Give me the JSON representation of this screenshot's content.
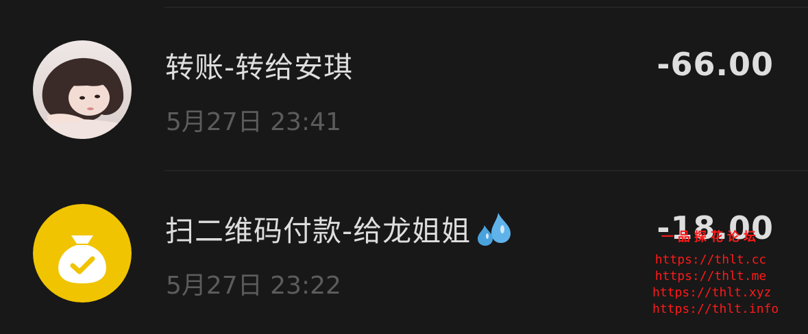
{
  "transactions": [
    {
      "title": "转账-转给安琪",
      "time": "5月27日 23:41",
      "amount": "-66.00",
      "avatar_icon": "user-avatar-photo"
    },
    {
      "title": "扫二维码付款-给龙姐姐",
      "time": "5月27日 23:22",
      "amount": "-18.00",
      "avatar_icon": "money-bag-check-icon",
      "title_emoji": "sweat-droplets-icon"
    }
  ],
  "watermark": {
    "title": "一品探花论坛",
    "lines": [
      "https://thlt.cc",
      "https://thlt.me",
      "https://thlt.xyz",
      "https://thlt.info"
    ]
  },
  "colors": {
    "background": "#181818",
    "text_primary": "#dedede",
    "text_secondary": "#5c5c5c",
    "icon_yellow": "#f0c400",
    "watermark_red": "#ff1a1a"
  }
}
